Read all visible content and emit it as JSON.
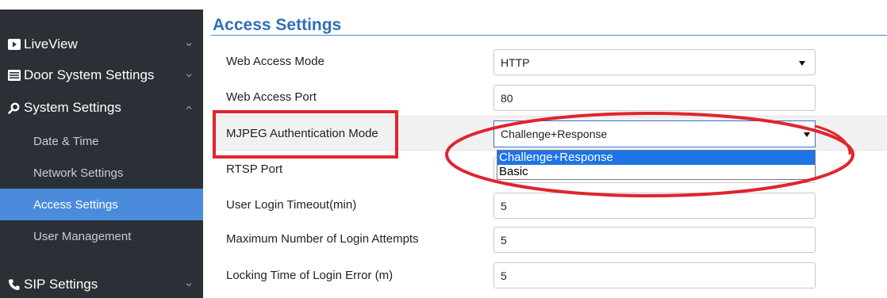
{
  "sidebar": {
    "sections": [
      {
        "label": "LiveView",
        "icon": "play-icon",
        "chevron": "down"
      },
      {
        "label": "Door System Settings",
        "icon": "door-panel-icon",
        "chevron": "down"
      },
      {
        "label": "System Settings",
        "icon": "gear-icon",
        "chevron": "up"
      },
      {
        "label": "SIP Settings",
        "icon": "phone-icon",
        "chevron": "down"
      }
    ],
    "subitems": [
      {
        "label": "Date & Time",
        "active": false
      },
      {
        "label": "Network Settings",
        "active": false
      },
      {
        "label": "Access Settings",
        "active": true
      },
      {
        "label": "User Management",
        "active": false
      }
    ]
  },
  "page": {
    "title": "Access Settings"
  },
  "form": {
    "rows": [
      {
        "label": "Web Access Mode",
        "type": "select",
        "value": "HTTP"
      },
      {
        "label": "Web Access Port",
        "type": "input",
        "value": "80"
      },
      {
        "label": "MJPEG Authentication Mode",
        "type": "select-open",
        "value": "Challenge+Response"
      },
      {
        "label": "RTSP Port",
        "type": "input",
        "value": ""
      },
      {
        "label": "User Login Timeout(min)",
        "type": "input",
        "value": "5"
      },
      {
        "label": "Maximum Number of Login Attempts",
        "type": "input",
        "value": "5"
      },
      {
        "label": "Locking Time of Login Error (m)",
        "type": "input",
        "value": "5"
      }
    ],
    "dropdown_options": [
      {
        "label": "Challenge+Response",
        "selected": true
      },
      {
        "label": "Basic",
        "selected": false
      }
    ]
  },
  "annotations": {
    "highlight_color": "#e0252e"
  },
  "colors": {
    "sidebar_bg": "#2b2f36",
    "active_item": "#4a8bdb",
    "title": "#2f6fb7",
    "option_selected": "#1e74e6"
  }
}
